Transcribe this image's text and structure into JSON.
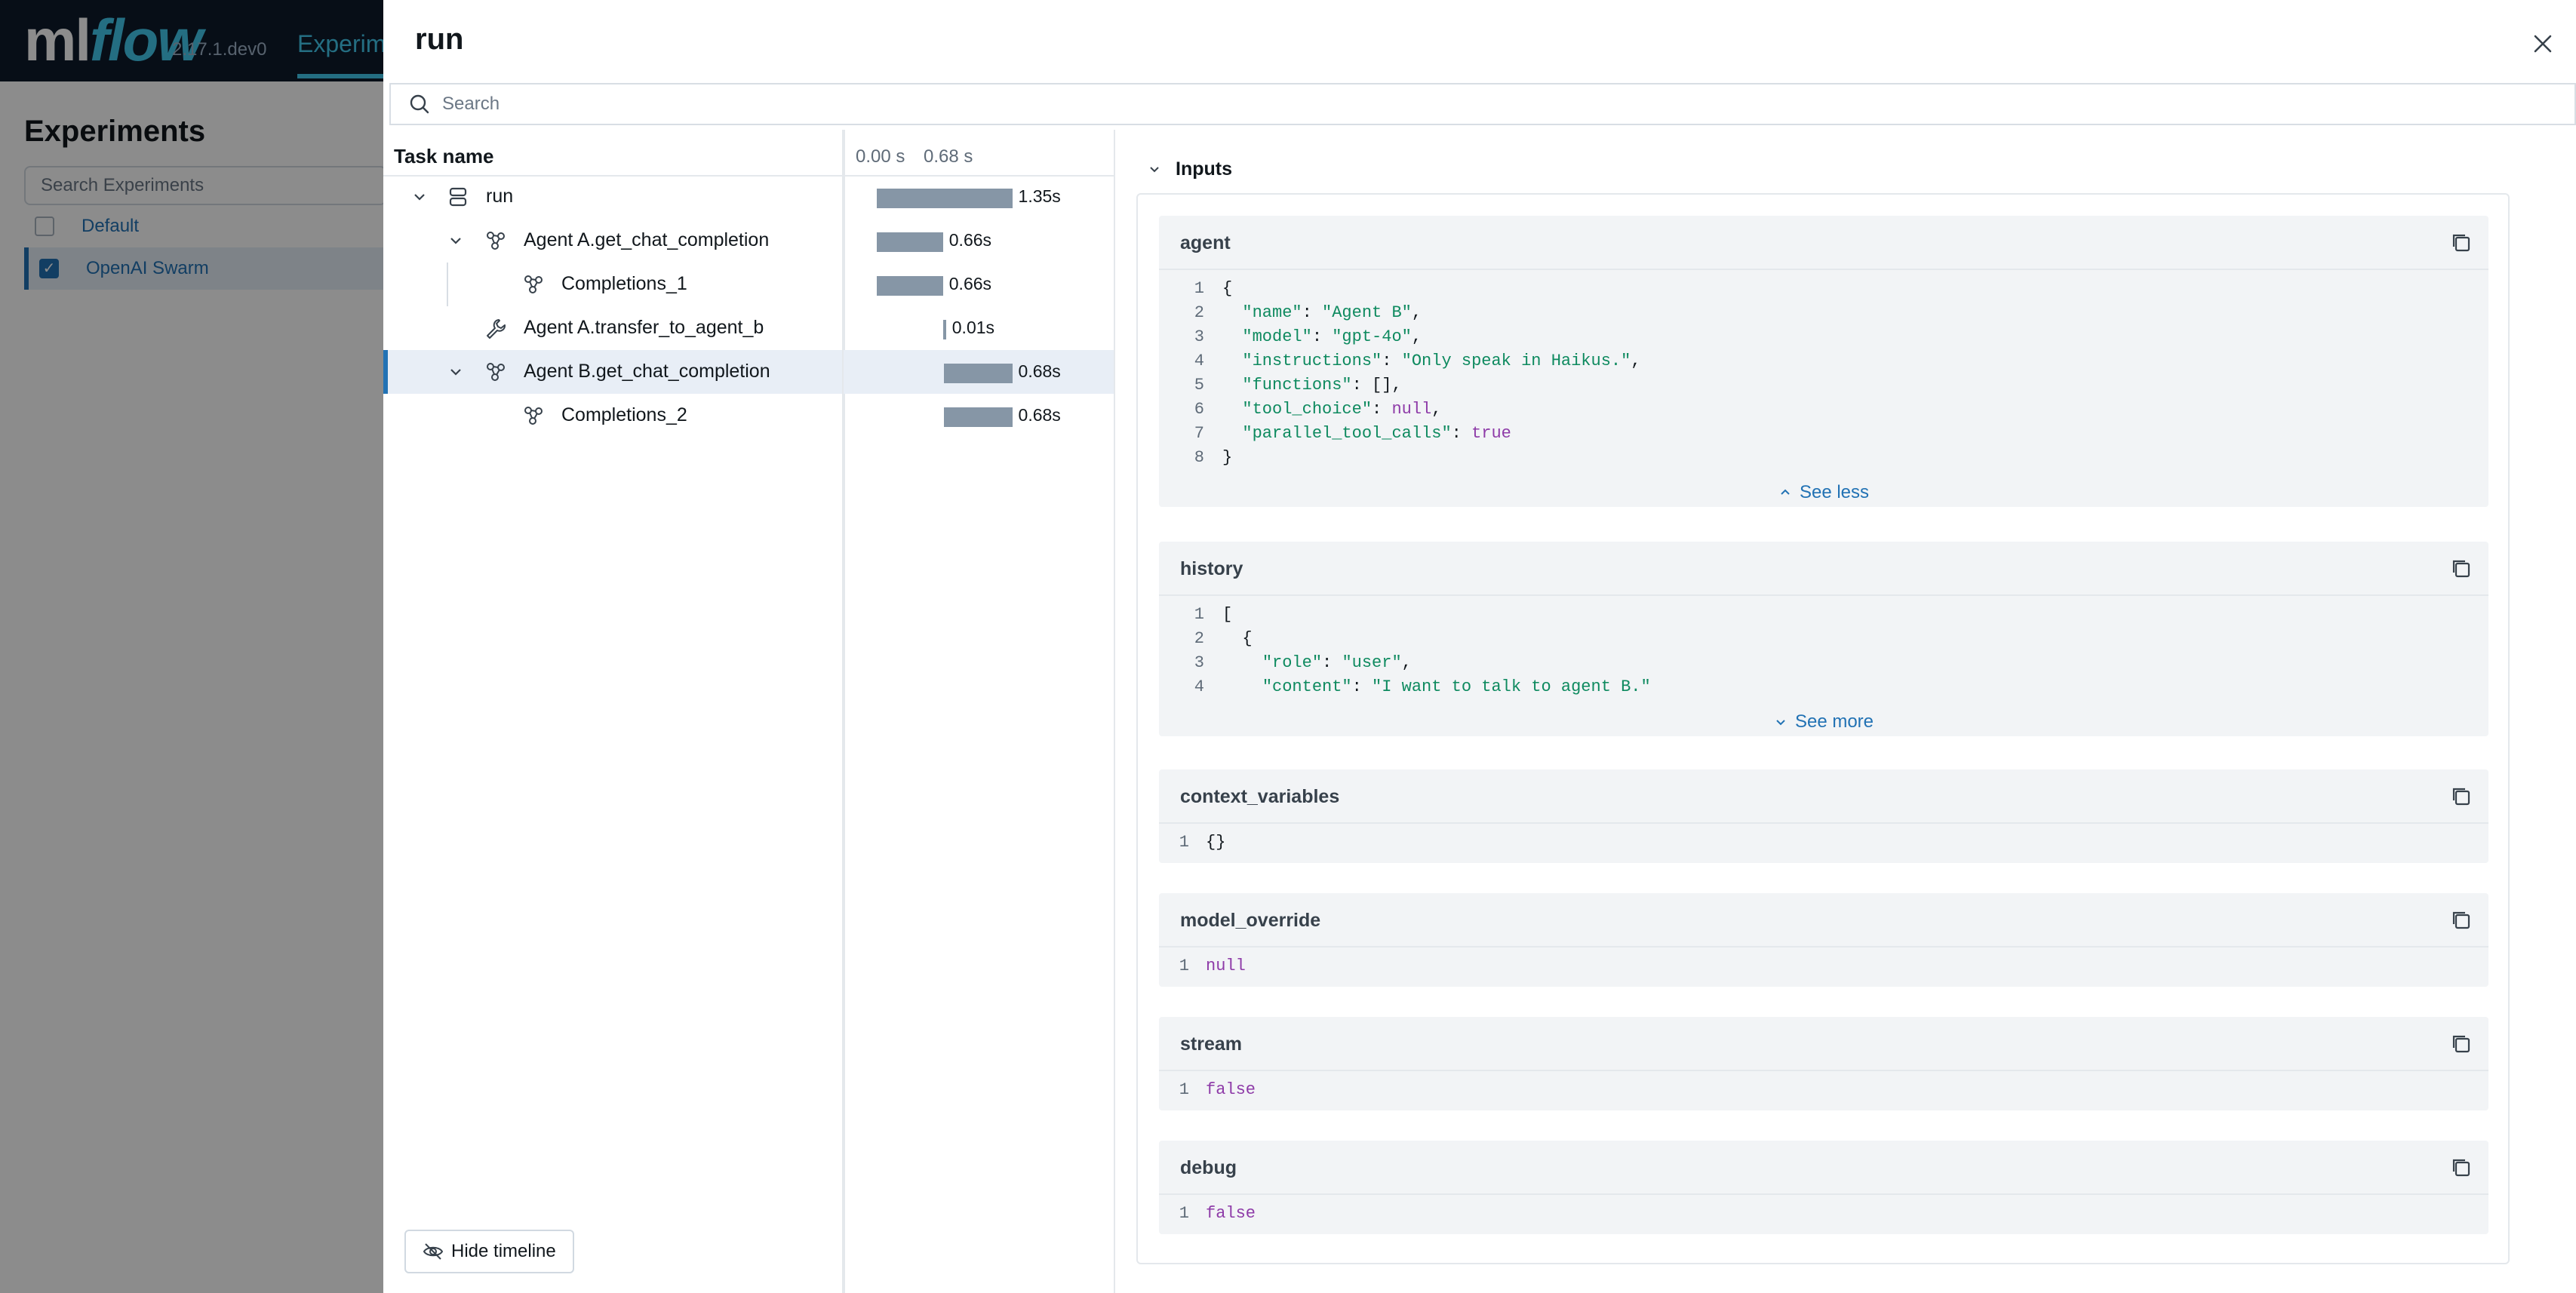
{
  "background_app": {
    "logo_main": "ml",
    "logo_accent": "flow",
    "version": "2.17.1.dev0",
    "nav_experiments": "Experime",
    "page_title": "Experiments",
    "search_placeholder": "Search Experiments",
    "experiments": [
      {
        "label": "Default",
        "selected": false
      },
      {
        "label": "OpenAI Swarm",
        "selected": true
      }
    ]
  },
  "drawer": {
    "title": "run",
    "search_placeholder": "Search",
    "tree": {
      "column_task_name": "Task name",
      "timeline_ticks": [
        "0.00 s",
        "0.68 s"
      ],
      "spans": [
        {
          "label": "run",
          "duration": "1.35s",
          "icon": "stack-icon",
          "expandable": true,
          "start_s": 0.0,
          "length_s": 1.35
        },
        {
          "label": "Agent A.get_chat_completion",
          "duration": "0.66s",
          "icon": "chain-icon",
          "expandable": true,
          "start_s": 0.0,
          "length_s": 0.66
        },
        {
          "label": "Completions_1",
          "duration": "0.66s",
          "icon": "chain-icon",
          "expandable": false,
          "start_s": 0.0,
          "length_s": 0.66
        },
        {
          "label": "Agent A.transfer_to_agent_b",
          "duration": "0.01s",
          "icon": "wrench-icon",
          "expandable": false,
          "start_s": 0.66,
          "length_s": 0.01
        },
        {
          "label": "Agent B.get_chat_completion",
          "duration": "0.68s",
          "icon": "chain-icon",
          "expandable": true,
          "start_s": 0.67,
          "length_s": 0.68,
          "selected": true
        },
        {
          "label": "Completions_2",
          "duration": "0.68s",
          "icon": "chain-icon",
          "expandable": false,
          "start_s": 0.67,
          "length_s": 0.68
        }
      ],
      "hide_timeline_label": "Hide timeline"
    },
    "detail": {
      "section_title": "Inputs",
      "fields": [
        {
          "name": "agent",
          "lines": [
            "{",
            "  \"name\": \"Agent B\",",
            "  \"model\": \"gpt-4o\",",
            "  \"instructions\": \"Only speak in Haikus.\",",
            "  \"functions\": [],",
            "  \"tool_choice\": null,",
            "  \"parallel_tool_calls\": true",
            "}"
          ],
          "toggle_label": "See less"
        },
        {
          "name": "history",
          "lines": [
            "[",
            "  {",
            "    \"role\": \"user\",",
            "    \"content\": \"I want to talk to agent B.\""
          ],
          "toggle_label": "See more"
        },
        {
          "name": "context_variables",
          "lines": [
            "{}"
          ]
        },
        {
          "name": "model_override",
          "lines": [
            "null"
          ]
        },
        {
          "name": "stream",
          "lines": [
            "false"
          ]
        },
        {
          "name": "debug",
          "lines": [
            "false"
          ]
        }
      ]
    }
  },
  "colors": {
    "accent": "#2272b4",
    "bar": "#8696a6",
    "json_key": "#0e8a5f",
    "json_keyword": "#8e3ba8"
  }
}
